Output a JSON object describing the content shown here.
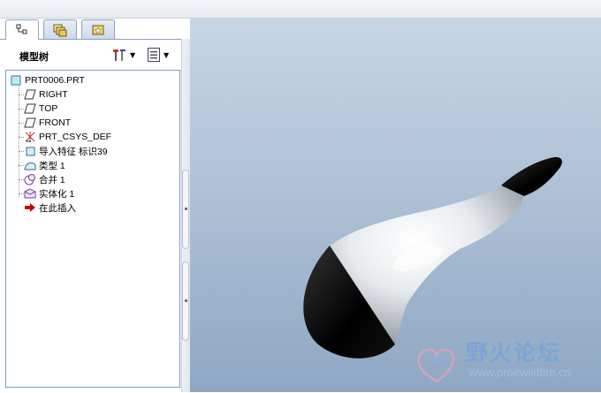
{
  "window": {
    "top_strip": ""
  },
  "tabs": [
    {
      "name": "model-tree",
      "icon": "tree-icon",
      "active": true
    },
    {
      "name": "folder-browser",
      "icon": "folders-icon",
      "active": false
    },
    {
      "name": "favorites",
      "icon": "favorites-icon",
      "active": false
    }
  ],
  "model_tree": {
    "title": "模型树",
    "settings_icon": "tools-icon",
    "show_icon": "list-icon",
    "root": {
      "label": "PRT0006.PRT",
      "icon": "part-icon"
    },
    "items": [
      {
        "label": "RIGHT",
        "icon": "datum-plane-icon"
      },
      {
        "label": "TOP",
        "icon": "datum-plane-icon"
      },
      {
        "label": "FRONT",
        "icon": "datum-plane-icon"
      },
      {
        "label": "PRT_CSYS_DEF",
        "icon": "csys-icon"
      },
      {
        "label": "导入特征 标识39",
        "icon": "import-feature-icon"
      },
      {
        "label": "类型 1",
        "icon": "style-icon"
      },
      {
        "label": "合并 1",
        "icon": "merge-icon"
      },
      {
        "label": "实体化 1",
        "icon": "solidify-icon"
      },
      {
        "label": "在此插入",
        "icon": "insert-here-arrow-icon"
      }
    ]
  },
  "watermark": {
    "brand": "野火论坛",
    "url": "www.proewildfire.cn"
  },
  "colors": {
    "viewport_top": "#c7d5e5",
    "viewport_bottom": "#8ea7c3",
    "insert_arrow": "#cc0000",
    "panel_border": "#7f9db9"
  }
}
